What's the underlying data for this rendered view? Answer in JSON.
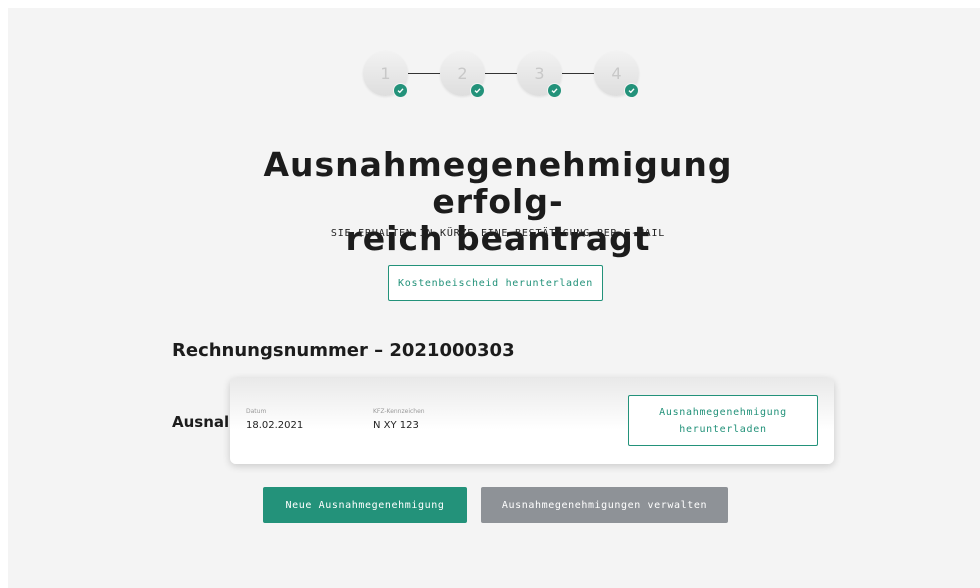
{
  "stepper": {
    "steps": [
      {
        "number": "1",
        "completed": true
      },
      {
        "number": "2",
        "completed": true
      },
      {
        "number": "3",
        "completed": true
      },
      {
        "number": "4",
        "completed": true
      }
    ]
  },
  "confirmation": {
    "title_line1": "Ausnahmegenehmigung erfolg-",
    "title_line2": "reich beantragt",
    "subtitle": "SIE ERHALTEN IN KÜRZE EINE BESTÄTIGUNG PER E-MAIL",
    "download_fee_notice_label": "Kostenbeischeid herunterladen"
  },
  "invoice": {
    "heading": "Rechnungsnummer – 2021000303"
  },
  "permit": {
    "heading": "Ausnal",
    "date_label": "Datum",
    "date_value": "18.02.2021",
    "plate_label": "KFZ-Kennzeichen",
    "plate_value": "N XY 123",
    "download_label_line1": "Ausnahmegenehmigung",
    "download_label_line2": "herunterladen"
  },
  "actions": {
    "new_permit_label": "Neue Ausnahmegenehmigung",
    "manage_permits_label": "Ausnahmegenehmigungen verwalten"
  },
  "colors": {
    "accent": "#23927a",
    "secondary_button": "#8e9297",
    "background": "#f4f4f4"
  }
}
